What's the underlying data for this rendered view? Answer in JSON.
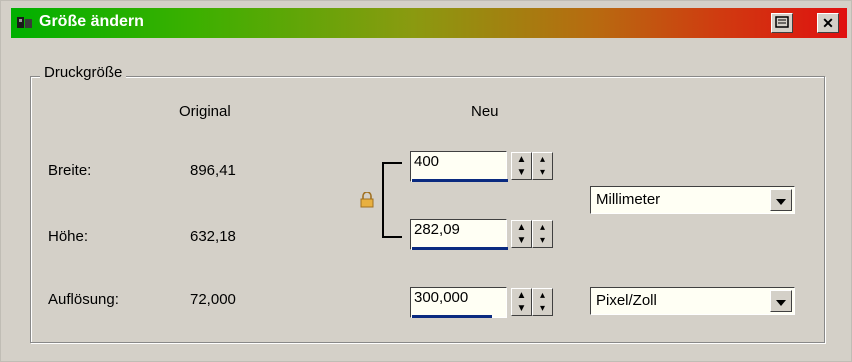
{
  "window": {
    "title": "Größe ändern"
  },
  "group": {
    "label": "Druckgröße"
  },
  "columns": {
    "original": "Original",
    "new": "Neu"
  },
  "rows": {
    "width_label": "Breite:",
    "height_label": "Höhe:",
    "resolution_label": "Auflösung:",
    "width_original": "896,41",
    "height_original": "632,18",
    "resolution_original": "72,000"
  },
  "inputs": {
    "width_value": "400",
    "height_value": "282,09",
    "resolution_value": "300,000"
  },
  "unit_select": {
    "selected": "Millimeter"
  },
  "resolution_unit_select": {
    "selected": "Pixel/Zoll"
  },
  "colors": {
    "title_gradient_start": "#00b000",
    "title_gradient_end": "#e01010",
    "field_bg": "#fffff4",
    "progress_bar": "#0a2a80"
  },
  "icons": {
    "app": "app-icon",
    "help": "help-icon",
    "close": "close-icon",
    "lock": "lock-icon",
    "spin": "spin-updown-icon",
    "dropdown": "chevron-down-icon"
  }
}
